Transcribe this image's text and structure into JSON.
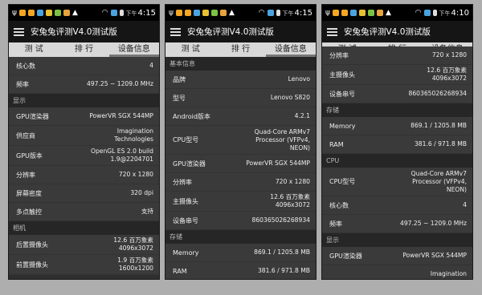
{
  "common": {
    "title": "安兔兔评测V4.0测试版",
    "tabs": [
      "测 试",
      "排 行",
      "设备信息"
    ],
    "pm_label": "下午"
  },
  "screens": [
    {
      "time": "4:15",
      "sections": [
        {
          "type": "row",
          "label": "核心数",
          "value": "4"
        },
        {
          "type": "row",
          "label": "频率",
          "value": "497.25 ~ 1209.0 MHz"
        },
        {
          "type": "section",
          "label": "显示"
        },
        {
          "type": "row",
          "label": "GPU渲染器",
          "value": "PowerVR SGX 544MP"
        },
        {
          "type": "row",
          "label": "供应商",
          "value": "Imagination\nTechnologies"
        },
        {
          "type": "row",
          "label": "GPU版本",
          "value": "OpenGL ES 2.0 build\n1.9@2204701"
        },
        {
          "type": "row",
          "label": "分辨率",
          "value": "720 x 1280"
        },
        {
          "type": "row",
          "label": "屏幕密度",
          "value": "320 dpi"
        },
        {
          "type": "row",
          "label": "多点触控",
          "value": "支持"
        },
        {
          "type": "section",
          "label": "相机"
        },
        {
          "type": "row",
          "label": "后置摄像头",
          "value": "12.6 百万象素\n4096x3072"
        },
        {
          "type": "row",
          "label": "前置摄像头",
          "value": "1.9 百万象素\n1600x1200"
        }
      ]
    },
    {
      "time": "4:15",
      "sections": [
        {
          "type": "section",
          "label": "基本信息"
        },
        {
          "type": "row",
          "label": "品牌",
          "value": "Lenovo"
        },
        {
          "type": "row",
          "label": "型号",
          "value": "Lenovo S820"
        },
        {
          "type": "row",
          "label": "Android版本",
          "value": "4.2.1"
        },
        {
          "type": "row",
          "label": "CPU型号",
          "value": "Quad-Core ARMv7\nProcessor (VFPv4,\nNEON)"
        },
        {
          "type": "row",
          "label": "GPU渲染器",
          "value": "PowerVR SGX 544MP"
        },
        {
          "type": "row",
          "label": "分辨率",
          "value": "720 x 1280"
        },
        {
          "type": "row",
          "label": "主摄像头",
          "value": "12.6 百万象素\n4096x3072"
        },
        {
          "type": "row",
          "label": "设备串号",
          "value": "860365026268934"
        },
        {
          "type": "section",
          "label": "存储"
        },
        {
          "type": "row",
          "label": "Memory",
          "value": "869.1 / 1205.8 MB"
        },
        {
          "type": "row",
          "label": "RAM",
          "value": "381.6 / 971.8 MB"
        }
      ]
    },
    {
      "time": "4:10",
      "sections": [
        {
          "type": "row",
          "label": "分辨率",
          "value": "720 x 1280"
        },
        {
          "type": "row",
          "label": "主摄像头",
          "value": "12.6 百万象素\n4096x3072"
        },
        {
          "type": "row",
          "label": "设备串号",
          "value": "860365026268934"
        },
        {
          "type": "section",
          "label": "存储"
        },
        {
          "type": "row",
          "label": "Memory",
          "value": "869.1 / 1205.8 MB"
        },
        {
          "type": "row",
          "label": "RAM",
          "value": "381.6 / 971.8 MB"
        },
        {
          "type": "section",
          "label": "CPU"
        },
        {
          "type": "row",
          "label": "CPU型号",
          "value": "Quad-Core ARMv7\nProcessor (VFPv4,\nNEON)"
        },
        {
          "type": "row",
          "label": "核心数",
          "value": "4"
        },
        {
          "type": "row",
          "label": "频率",
          "value": "497.25 ~ 1209.0 MHz"
        },
        {
          "type": "section",
          "label": "显示"
        },
        {
          "type": "row",
          "label": "GPU渲染器",
          "value": "PowerVR SGX 544MP"
        },
        {
          "type": "row",
          "label": "",
          "value": "Imagination"
        }
      ]
    }
  ],
  "status_icons": [
    {
      "name": "usb-icon",
      "color": "#ffffff"
    },
    {
      "name": "antutu-icon",
      "color": "#f5a623"
    },
    {
      "name": "antutu-icon-2",
      "color": "#f5a623"
    },
    {
      "name": "network-icon",
      "color": "#4aa3df"
    },
    {
      "name": "mail-icon",
      "color": "#e8c130"
    },
    {
      "name": "whatsapp-icon",
      "color": "#7cc242"
    },
    {
      "name": "cat-icon",
      "color": "#e8a33c"
    },
    {
      "name": "warning-icon",
      "color": "#ffffff"
    }
  ]
}
